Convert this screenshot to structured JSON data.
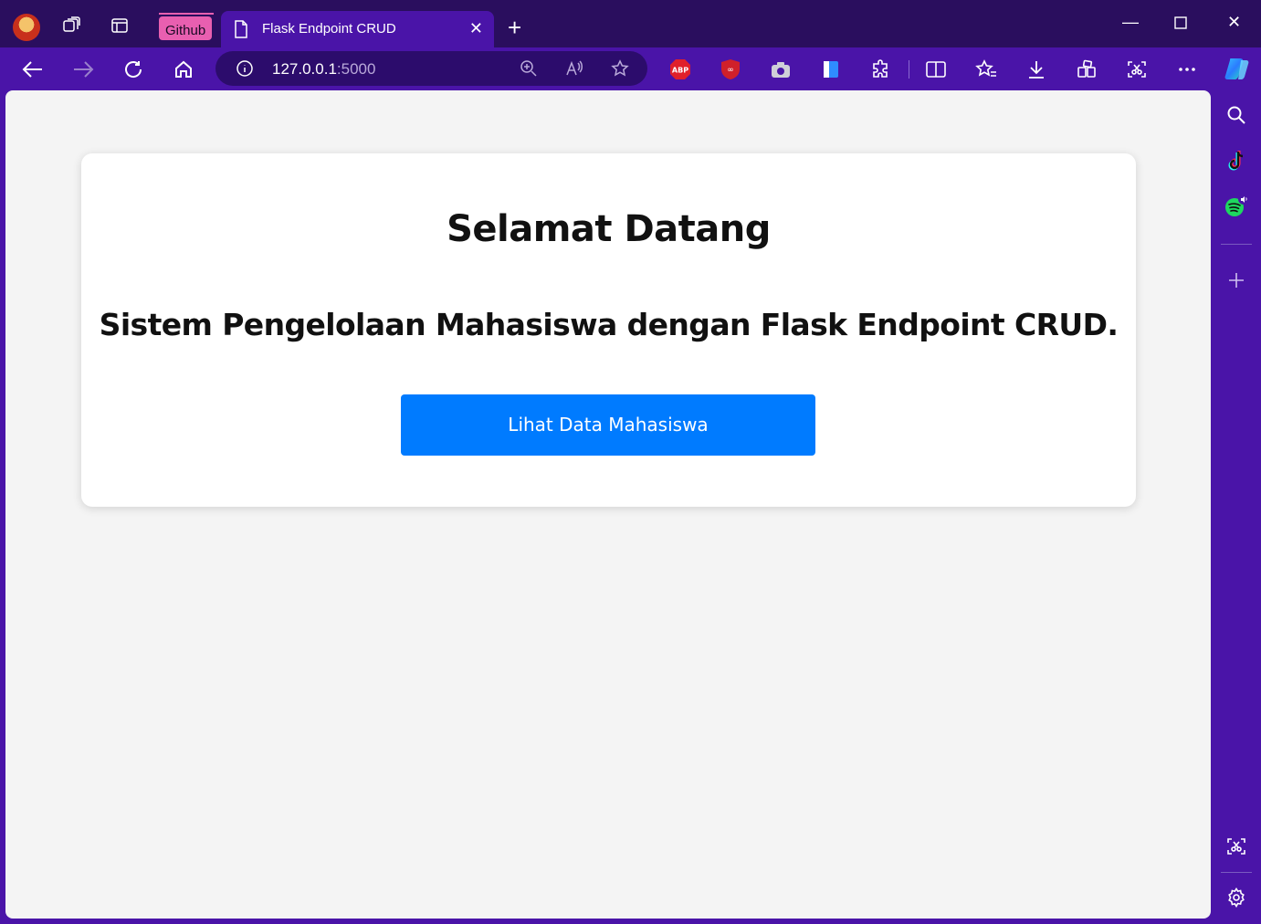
{
  "browser": {
    "tab_group_label": "Github",
    "active_tab_title": "Flask Endpoint CRUD",
    "url_host": "127.0.0.1",
    "url_port": ":5000",
    "extensions": [
      "abp-icon",
      "ublock-icon",
      "camera-icon",
      "bookmark-book-icon",
      "puzzle-icon"
    ],
    "accent": "#4a14a8",
    "titlebar_color": "#2a0e5e"
  },
  "page": {
    "heading": "Selamat Datang",
    "subheading": "Sistem Pengelolaan Mahasiswa dengan Flask Endpoint CRUD.",
    "button_label": "Lihat Data Mahasiswa",
    "button_color": "#007bff"
  },
  "sidebar": {
    "items": [
      "search-icon",
      "tiktok-icon",
      "spotify-icon",
      "add-icon",
      "screenshot-icon",
      "settings-icon"
    ]
  }
}
